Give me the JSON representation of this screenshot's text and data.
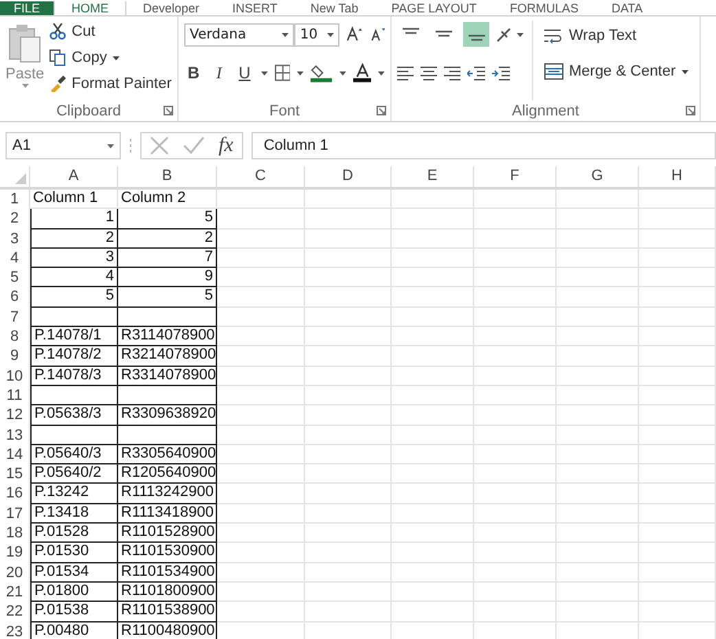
{
  "tabs": [
    {
      "label": "FILE",
      "selected": false,
      "kind": "file"
    },
    {
      "label": "HOME",
      "selected": true,
      "kind": "tab"
    },
    {
      "label": "Developer",
      "selected": false,
      "kind": "tab"
    },
    {
      "label": "INSERT",
      "selected": false,
      "kind": "tab"
    },
    {
      "label": "New Tab",
      "selected": false,
      "kind": "tab"
    },
    {
      "label": "PAGE LAYOUT",
      "selected": false,
      "kind": "tab"
    },
    {
      "label": "FORMULAS",
      "selected": false,
      "kind": "tab"
    },
    {
      "label": "DATA",
      "selected": false,
      "kind": "tab"
    }
  ],
  "clipboard": {
    "paste": "Paste",
    "cut": "Cut",
    "copy": "Copy",
    "format_painter": "Format Painter",
    "label": "Clipboard"
  },
  "font": {
    "font_name": "Verdana",
    "font_size": "10",
    "bold": "B",
    "italic": "I",
    "underline": "U",
    "label": "Font"
  },
  "alignment": {
    "vertical_align": [
      {
        "selected": false
      },
      {
        "selected": false
      },
      {
        "selected": true
      }
    ],
    "wrap_text": "Wrap Text",
    "merge_center": "Merge & Center",
    "label": "Alignment"
  },
  "formula_bar": {
    "name_box": "A1",
    "fx": "fx",
    "formula": "Column 1"
  },
  "columns": [
    "A",
    "B",
    "C",
    "D",
    "E",
    "F",
    "G",
    "H"
  ],
  "rows": [
    {
      "number": "1",
      "bordered": false,
      "kind": "text",
      "cells": [
        "Column 1",
        "Column 2"
      ]
    },
    {
      "number": "2",
      "bordered": true,
      "kind": "number",
      "cells": [
        "1",
        "5"
      ]
    },
    {
      "number": "3",
      "bordered": true,
      "kind": "number",
      "cells": [
        "2",
        "2"
      ]
    },
    {
      "number": "4",
      "bordered": true,
      "kind": "number",
      "cells": [
        "3",
        "7"
      ]
    },
    {
      "number": "5",
      "bordered": true,
      "kind": "number",
      "cells": [
        "4",
        "9"
      ]
    },
    {
      "number": "6",
      "bordered": true,
      "kind": "number",
      "cells": [
        "5",
        "5"
      ]
    },
    {
      "number": "7",
      "bordered": true,
      "kind": "text"
    },
    {
      "number": "8",
      "bordered": true,
      "kind": "text",
      "cells": [
        "P.14078/1",
        "R3114078900"
      ]
    },
    {
      "number": "9",
      "bordered": true,
      "kind": "text",
      "cells": [
        "P.14078/2",
        "R3214078900"
      ]
    },
    {
      "number": "10",
      "bordered": true,
      "kind": "text",
      "cells": [
        "P.14078/3",
        "R3314078900"
      ]
    },
    {
      "number": "11",
      "bordered": true,
      "kind": "text"
    },
    {
      "number": "12",
      "bordered": true,
      "kind": "text",
      "cells": [
        "P.05638/3",
        "R3309638920"
      ]
    },
    {
      "number": "13",
      "bordered": true,
      "kind": "text"
    },
    {
      "number": "14",
      "bordered": true,
      "kind": "text",
      "cells": [
        "P.05640/3",
        "R3305640900"
      ]
    },
    {
      "number": "15",
      "bordered": true,
      "kind": "text",
      "cells": [
        "P.05640/2",
        "R1205640900"
      ]
    },
    {
      "number": "16",
      "bordered": true,
      "kind": "text",
      "cells": [
        "P.13242",
        "R1113242900"
      ]
    },
    {
      "number": "17",
      "bordered": true,
      "kind": "text",
      "cells": [
        "P.13418",
        "R1113418900"
      ]
    },
    {
      "number": "18",
      "bordered": true,
      "kind": "text",
      "cells": [
        "P.01528",
        "R1101528900"
      ]
    },
    {
      "number": "19",
      "bordered": true,
      "kind": "text",
      "cells": [
        "P.01530",
        "R1101530900"
      ]
    },
    {
      "number": "20",
      "bordered": true,
      "kind": "text",
      "cells": [
        "P.01534",
        "R1101534900"
      ]
    },
    {
      "number": "21",
      "bordered": true,
      "kind": "text",
      "cells": [
        "P.01800",
        "R1101800900"
      ]
    },
    {
      "number": "22",
      "bordered": true,
      "kind": "text",
      "cells": [
        "P.01538",
        "R1101538900"
      ]
    },
    {
      "number": "23",
      "bordered": true,
      "kind": "text",
      "cells": [
        "P.00480",
        "R1100480900"
      ]
    }
  ]
}
